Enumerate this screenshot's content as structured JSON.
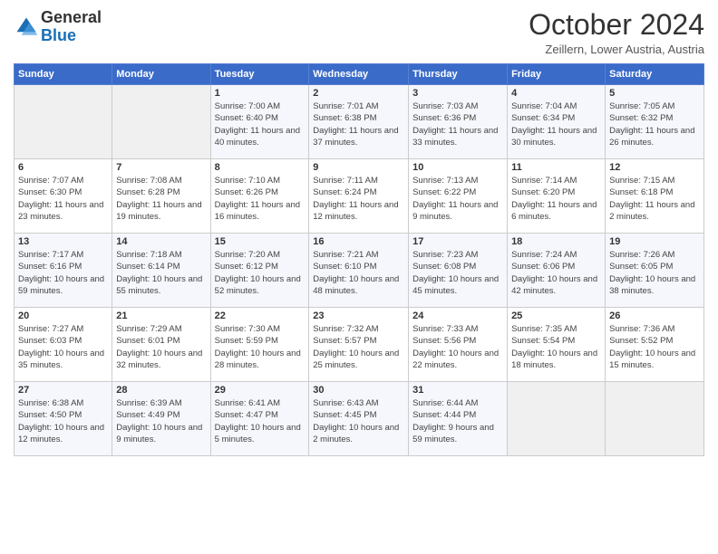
{
  "header": {
    "logo_general": "General",
    "logo_blue": "Blue",
    "month_title": "October 2024",
    "location": "Zeillern, Lower Austria, Austria"
  },
  "weekdays": [
    "Sunday",
    "Monday",
    "Tuesday",
    "Wednesday",
    "Thursday",
    "Friday",
    "Saturday"
  ],
  "weeks": [
    [
      {
        "day": "",
        "info": ""
      },
      {
        "day": "",
        "info": ""
      },
      {
        "day": "1",
        "info": "Sunrise: 7:00 AM\nSunset: 6:40 PM\nDaylight: 11 hours and 40 minutes."
      },
      {
        "day": "2",
        "info": "Sunrise: 7:01 AM\nSunset: 6:38 PM\nDaylight: 11 hours and 37 minutes."
      },
      {
        "day": "3",
        "info": "Sunrise: 7:03 AM\nSunset: 6:36 PM\nDaylight: 11 hours and 33 minutes."
      },
      {
        "day": "4",
        "info": "Sunrise: 7:04 AM\nSunset: 6:34 PM\nDaylight: 11 hours and 30 minutes."
      },
      {
        "day": "5",
        "info": "Sunrise: 7:05 AM\nSunset: 6:32 PM\nDaylight: 11 hours and 26 minutes."
      }
    ],
    [
      {
        "day": "6",
        "info": "Sunrise: 7:07 AM\nSunset: 6:30 PM\nDaylight: 11 hours and 23 minutes."
      },
      {
        "day": "7",
        "info": "Sunrise: 7:08 AM\nSunset: 6:28 PM\nDaylight: 11 hours and 19 minutes."
      },
      {
        "day": "8",
        "info": "Sunrise: 7:10 AM\nSunset: 6:26 PM\nDaylight: 11 hours and 16 minutes."
      },
      {
        "day": "9",
        "info": "Sunrise: 7:11 AM\nSunset: 6:24 PM\nDaylight: 11 hours and 12 minutes."
      },
      {
        "day": "10",
        "info": "Sunrise: 7:13 AM\nSunset: 6:22 PM\nDaylight: 11 hours and 9 minutes."
      },
      {
        "day": "11",
        "info": "Sunrise: 7:14 AM\nSunset: 6:20 PM\nDaylight: 11 hours and 6 minutes."
      },
      {
        "day": "12",
        "info": "Sunrise: 7:15 AM\nSunset: 6:18 PM\nDaylight: 11 hours and 2 minutes."
      }
    ],
    [
      {
        "day": "13",
        "info": "Sunrise: 7:17 AM\nSunset: 6:16 PM\nDaylight: 10 hours and 59 minutes."
      },
      {
        "day": "14",
        "info": "Sunrise: 7:18 AM\nSunset: 6:14 PM\nDaylight: 10 hours and 55 minutes."
      },
      {
        "day": "15",
        "info": "Sunrise: 7:20 AM\nSunset: 6:12 PM\nDaylight: 10 hours and 52 minutes."
      },
      {
        "day": "16",
        "info": "Sunrise: 7:21 AM\nSunset: 6:10 PM\nDaylight: 10 hours and 48 minutes."
      },
      {
        "day": "17",
        "info": "Sunrise: 7:23 AM\nSunset: 6:08 PM\nDaylight: 10 hours and 45 minutes."
      },
      {
        "day": "18",
        "info": "Sunrise: 7:24 AM\nSunset: 6:06 PM\nDaylight: 10 hours and 42 minutes."
      },
      {
        "day": "19",
        "info": "Sunrise: 7:26 AM\nSunset: 6:05 PM\nDaylight: 10 hours and 38 minutes."
      }
    ],
    [
      {
        "day": "20",
        "info": "Sunrise: 7:27 AM\nSunset: 6:03 PM\nDaylight: 10 hours and 35 minutes."
      },
      {
        "day": "21",
        "info": "Sunrise: 7:29 AM\nSunset: 6:01 PM\nDaylight: 10 hours and 32 minutes."
      },
      {
        "day": "22",
        "info": "Sunrise: 7:30 AM\nSunset: 5:59 PM\nDaylight: 10 hours and 28 minutes."
      },
      {
        "day": "23",
        "info": "Sunrise: 7:32 AM\nSunset: 5:57 PM\nDaylight: 10 hours and 25 minutes."
      },
      {
        "day": "24",
        "info": "Sunrise: 7:33 AM\nSunset: 5:56 PM\nDaylight: 10 hours and 22 minutes."
      },
      {
        "day": "25",
        "info": "Sunrise: 7:35 AM\nSunset: 5:54 PM\nDaylight: 10 hours and 18 minutes."
      },
      {
        "day": "26",
        "info": "Sunrise: 7:36 AM\nSunset: 5:52 PM\nDaylight: 10 hours and 15 minutes."
      }
    ],
    [
      {
        "day": "27",
        "info": "Sunrise: 6:38 AM\nSunset: 4:50 PM\nDaylight: 10 hours and 12 minutes."
      },
      {
        "day": "28",
        "info": "Sunrise: 6:39 AM\nSunset: 4:49 PM\nDaylight: 10 hours and 9 minutes."
      },
      {
        "day": "29",
        "info": "Sunrise: 6:41 AM\nSunset: 4:47 PM\nDaylight: 10 hours and 5 minutes."
      },
      {
        "day": "30",
        "info": "Sunrise: 6:43 AM\nSunset: 4:45 PM\nDaylight: 10 hours and 2 minutes."
      },
      {
        "day": "31",
        "info": "Sunrise: 6:44 AM\nSunset: 4:44 PM\nDaylight: 9 hours and 59 minutes."
      },
      {
        "day": "",
        "info": ""
      },
      {
        "day": "",
        "info": ""
      }
    ]
  ]
}
